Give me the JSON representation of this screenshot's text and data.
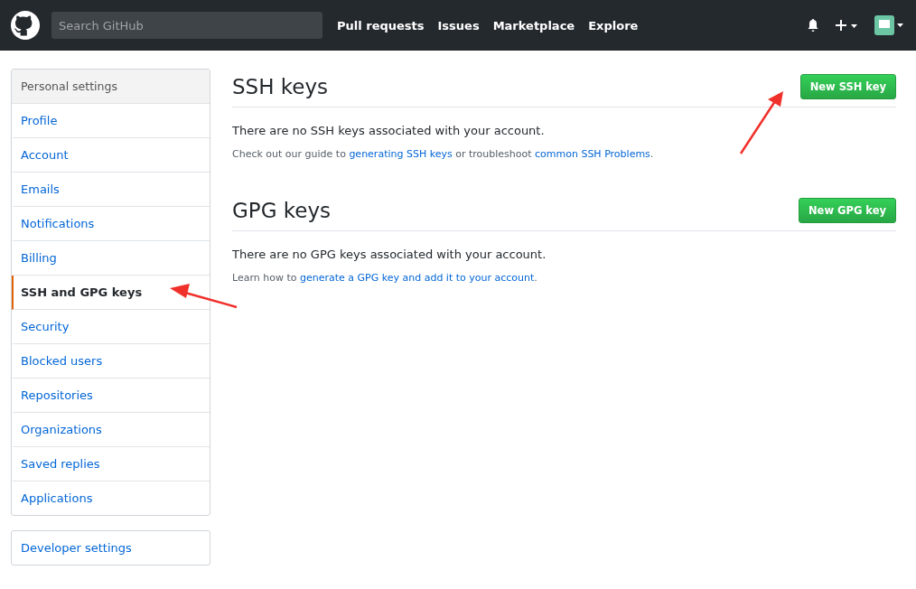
{
  "header": {
    "search": {
      "placeholder": "Search GitHub"
    },
    "nav": [
      "Pull requests",
      "Issues",
      "Marketplace",
      "Explore"
    ]
  },
  "sidebar": {
    "title": "Personal settings",
    "items": [
      {
        "label": "Profile",
        "selected": false
      },
      {
        "label": "Account",
        "selected": false
      },
      {
        "label": "Emails",
        "selected": false
      },
      {
        "label": "Notifications",
        "selected": false
      },
      {
        "label": "Billing",
        "selected": false
      },
      {
        "label": "SSH and GPG keys",
        "selected": true
      },
      {
        "label": "Security",
        "selected": false
      },
      {
        "label": "Blocked users",
        "selected": false
      },
      {
        "label": "Repositories",
        "selected": false
      },
      {
        "label": "Organizations",
        "selected": false
      },
      {
        "label": "Saved replies",
        "selected": false
      },
      {
        "label": "Applications",
        "selected": false
      }
    ],
    "developer": "Developer settings"
  },
  "sections": [
    {
      "title": "SSH keys",
      "button": "New SSH key",
      "message": "There are no SSH keys associated with your account.",
      "note": [
        {
          "kind": "text",
          "text": "Check out our guide to "
        },
        {
          "kind": "link",
          "text": "generating SSH keys"
        },
        {
          "kind": "text",
          "text": " or troubleshoot "
        },
        {
          "kind": "link",
          "text": "common SSH Problems"
        },
        {
          "kind": "text",
          "text": "."
        }
      ]
    },
    {
      "title": "GPG keys",
      "button": "New GPG key",
      "message": "There are no GPG keys associated with your account.",
      "note": [
        {
          "kind": "text",
          "text": "Learn how to "
        },
        {
          "kind": "link",
          "text": "generate a GPG key and add it to your account"
        },
        {
          "kind": "text",
          "text": "."
        }
      ]
    }
  ]
}
